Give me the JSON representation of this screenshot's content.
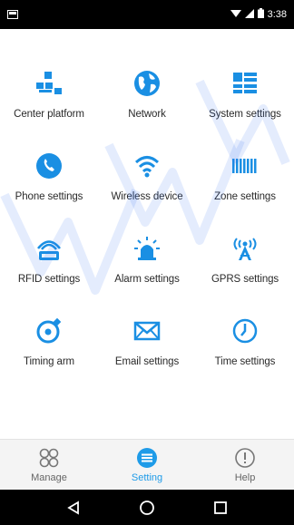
{
  "status_bar": {
    "time": "3:38"
  },
  "colors": {
    "accent": "#1e9be8",
    "icon_blue": "#1a8fe3",
    "status_bar": "#000000",
    "nav_bg": "#f4f4f4"
  },
  "tiles": [
    {
      "label": "Center platform",
      "icon": "center-platform-icon"
    },
    {
      "label": "Network",
      "icon": "globe-icon"
    },
    {
      "label": "System settings",
      "icon": "system-settings-icon"
    },
    {
      "label": "Phone settings",
      "icon": "phone-icon"
    },
    {
      "label": "Wireless device",
      "icon": "wifi-icon"
    },
    {
      "label": "Zone settings",
      "icon": "zone-icon"
    },
    {
      "label": "RFID settings",
      "icon": "rfid-icon"
    },
    {
      "label": "Alarm settings",
      "icon": "alarm-siren-icon"
    },
    {
      "label": "GPRS settings",
      "icon": "gprs-antenna-icon"
    },
    {
      "label": "Timing arm",
      "icon": "timing-arm-icon"
    },
    {
      "label": "Email settings",
      "icon": "email-icon"
    },
    {
      "label": "Time settings",
      "icon": "clock-icon"
    }
  ],
  "bottom_nav": {
    "items": [
      {
        "label": "Manage",
        "icon": "manage-icon",
        "active": false
      },
      {
        "label": "Setting",
        "icon": "setting-icon",
        "active": true
      },
      {
        "label": "Help",
        "icon": "help-icon",
        "active": false
      }
    ]
  },
  "android_nav": [
    "back-icon",
    "home-icon",
    "recents-icon"
  ]
}
